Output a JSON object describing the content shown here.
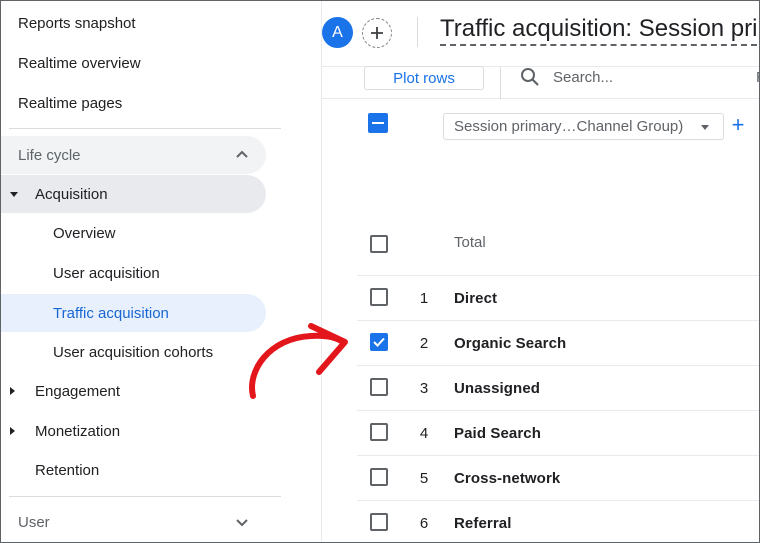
{
  "sidebar": {
    "top_items": [
      "Reports snapshot",
      "Realtime overview",
      "Realtime pages"
    ],
    "lifecycle_label": "Life cycle",
    "acquisition_label": "Acquisition",
    "acquisition_children": [
      "Overview",
      "User acquisition",
      "Traffic acquisition",
      "User acquisition cohorts"
    ],
    "active_item": "Traffic acquisition",
    "other_sections": [
      "Engagement",
      "Monetization",
      "Retention"
    ],
    "user_label": "User"
  },
  "header": {
    "avatar_letter": "A",
    "title": "Traffic acquisition: Session pri"
  },
  "toolbar": {
    "plot_rows_label": "Plot rows",
    "search_placeholder": "Search...",
    "right_clip": "R"
  },
  "table": {
    "dimension_select": "Session primary…Channel Group)",
    "total_label": "Total",
    "rows": [
      {
        "index": "1",
        "label": "Direct",
        "checked": false
      },
      {
        "index": "2",
        "label": "Organic Search",
        "checked": true
      },
      {
        "index": "3",
        "label": "Unassigned",
        "checked": false
      },
      {
        "index": "4",
        "label": "Paid Search",
        "checked": false
      },
      {
        "index": "5",
        "label": "Cross-network",
        "checked": false
      },
      {
        "index": "6",
        "label": "Referral",
        "checked": false
      }
    ]
  },
  "colors": {
    "accent": "#1a73e8",
    "active_bg": "#e8f0fe",
    "annotation_arrow": "#e3161c"
  },
  "icons": [
    "chevron-up-icon",
    "chevron-down-icon",
    "caret-down-icon",
    "caret-right-icon",
    "add-icon",
    "search-icon",
    "dropdown-triangle-icon",
    "checkbox-icon",
    "annotation-arrow-icon"
  ]
}
